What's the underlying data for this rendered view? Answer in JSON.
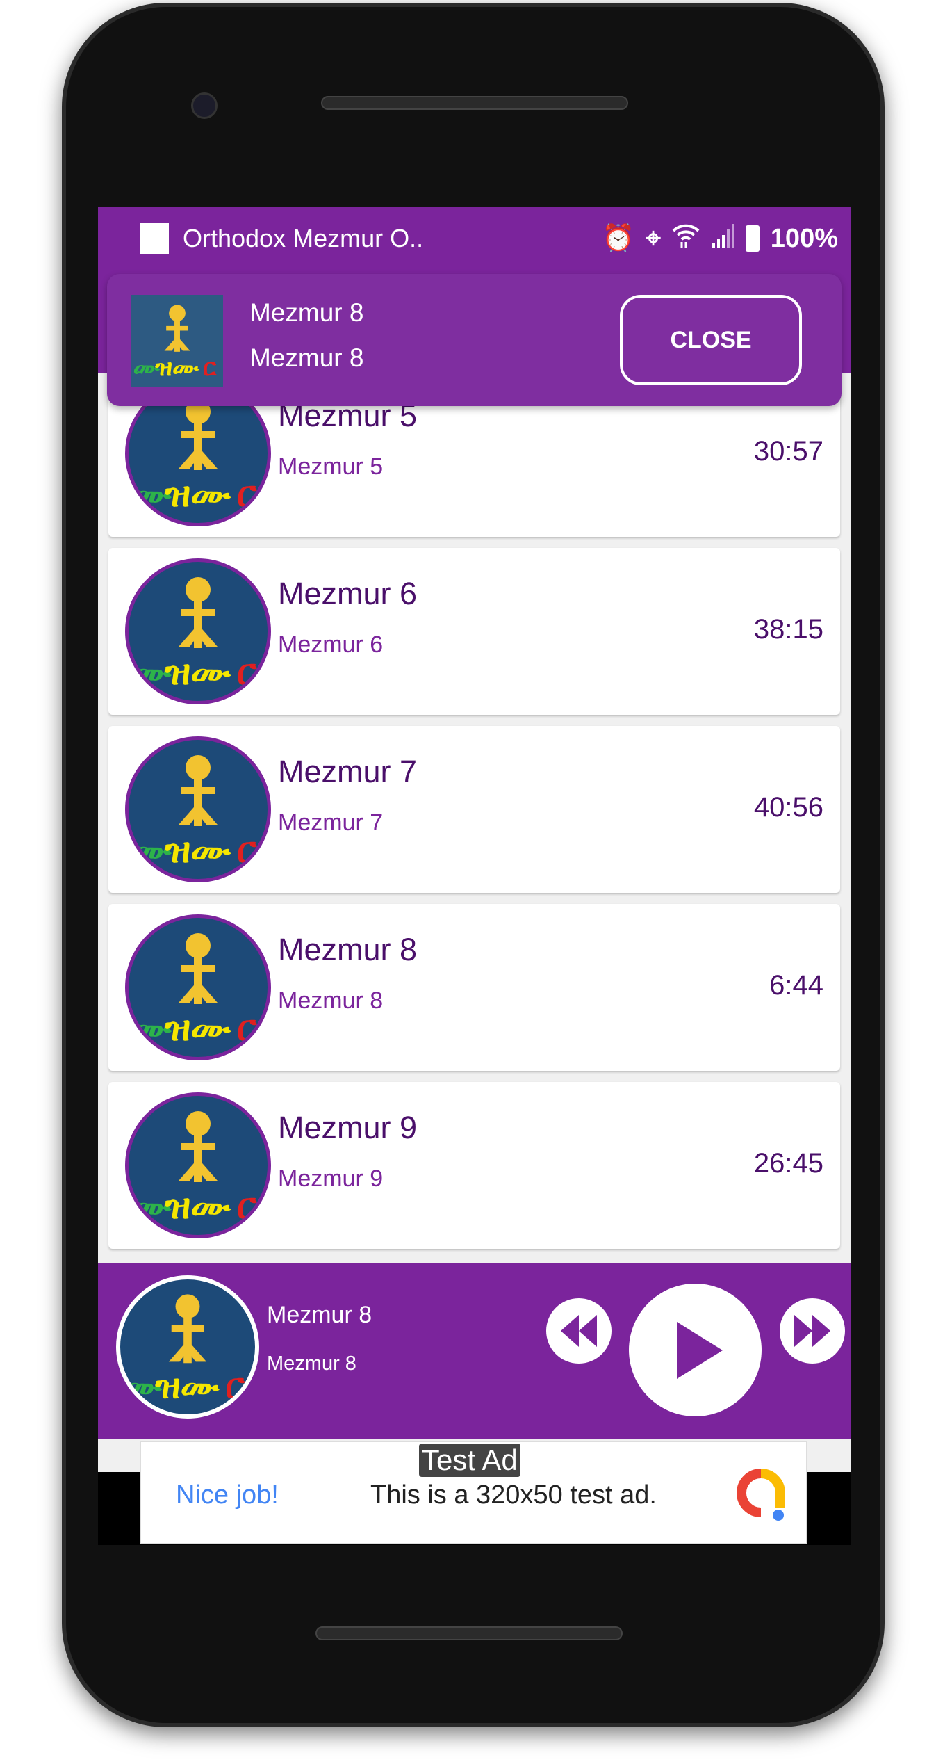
{
  "status_bar": {
    "app_title": "Orthodox Mezmur O..",
    "battery": "100%",
    "icons": [
      "alarm-icon",
      "location-icon",
      "wifi-icon",
      "signal-icon",
      "battery-icon"
    ]
  },
  "notification": {
    "title": "Mezmur 8",
    "subtitle": "Mezmur 8",
    "close_label": "CLOSE"
  },
  "list": [
    {
      "title": "Mezmur 5",
      "subtitle": "Mezmur 5",
      "duration": "30:57"
    },
    {
      "title": "Mezmur 6",
      "subtitle": "Mezmur 6",
      "duration": "38:15"
    },
    {
      "title": "Mezmur 7",
      "subtitle": "Mezmur 7",
      "duration": "40:56"
    },
    {
      "title": "Mezmur 8",
      "subtitle": "Mezmur 8",
      "duration": "6:44"
    },
    {
      "title": "Mezmur 9",
      "subtitle": "Mezmur 9",
      "duration": "26:45"
    }
  ],
  "player": {
    "title": "Mezmur 8",
    "subtitle": "Mezmur 8",
    "controls": [
      "rewind-icon",
      "play-icon",
      "fast-forward-icon"
    ]
  },
  "ad": {
    "label": "Test Ad",
    "headline": "Nice job!",
    "text": "This is a 320x50 test ad."
  },
  "colors": {
    "primary": "#7b249c",
    "title_text": "#4a0f6a",
    "logo_bg": "#1d4a78",
    "ad_link": "#4285f4"
  }
}
